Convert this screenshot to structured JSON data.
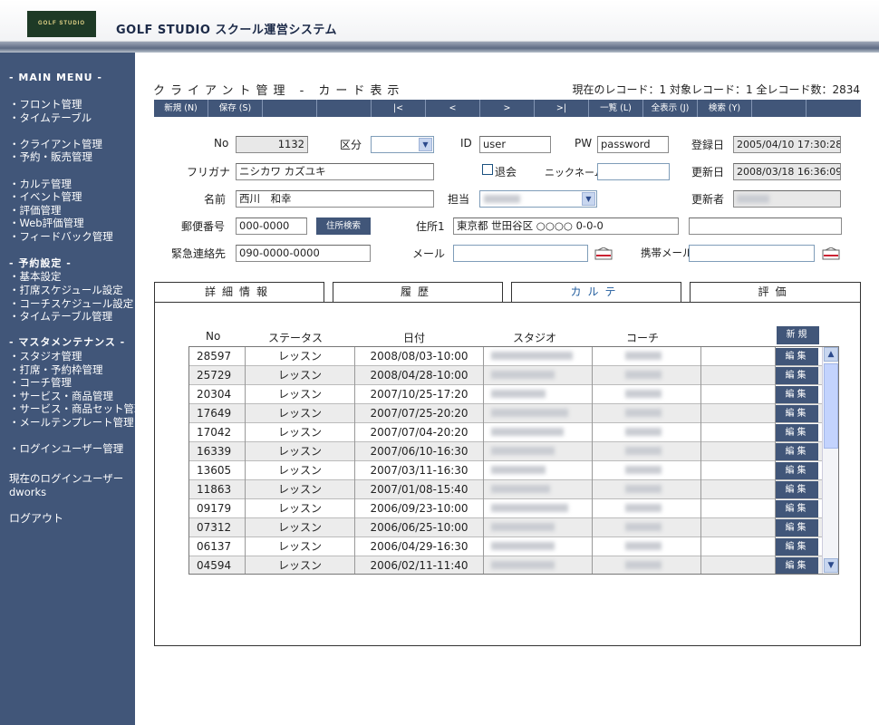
{
  "header": {
    "logo_text": "GOLF STUDIO",
    "app_title": "GOLF STUDIO スクール運営システム"
  },
  "sidebar": {
    "main_menu": "- MAIN MENU -",
    "items": [
      "・フロント管理",
      "・タイムテーブル",
      "・クライアント管理",
      "・予約・販売管理",
      "・カルテ管理",
      "・イベント管理",
      "・評価管理",
      "・Web評価管理",
      "・フィードバック管理"
    ],
    "reserve_head": "- 予約設定 -",
    "reserve_items": [
      "・基本設定",
      "・打席スケジュール設定",
      "・コーチスケジュール設定",
      "・タイムテーブル管理"
    ],
    "master_head": "- マスタメンテナンス -",
    "master_items": [
      "・スタジオ管理",
      "・打席・予約枠管理",
      "・コーチ管理",
      "・サービス・商品管理",
      "・サービス・商品セット管理",
      "・メールテンプレート管理"
    ],
    "login_user_mgmt": "・ログインユーザー管理",
    "current_user_label": "現在のログインユーザー",
    "current_user": "dworks",
    "logout": "ログアウト"
  },
  "page": {
    "title": "クライアント管理 - カード表示",
    "record_info": "現在のレコード：1 対象レコード：1 全レコード数：2834"
  },
  "toolbar": {
    "buttons": [
      "新規 (N)",
      "保存 (S)",
      "",
      "",
      "|<",
      "<",
      ">",
      ">|",
      "一覧 (L)",
      "全表示 (J)",
      "検索 (Y)",
      "",
      ""
    ]
  },
  "form": {
    "no_label": "No",
    "no_value": "1132",
    "kubun_label": "区分",
    "kubun_value": "",
    "id_label": "ID",
    "id_value": "user",
    "pw_label": "PW",
    "pw_value": "password",
    "registered_label": "登録日",
    "registered_value": "2005/04/10 17:30:28",
    "furigana_label": "フリガナ",
    "furigana_value": "ニシカワ カズユキ",
    "withdraw_label": "退会",
    "nickname_label": "ニックネーム",
    "nickname_value": "",
    "updated_label": "更新日",
    "updated_value": "2008/03/18 16:36:09",
    "name_label": "名前",
    "name_value": "西川　和幸",
    "staff_label": "担当",
    "updater_label": "更新者",
    "zip_label": "郵便番号",
    "zip_value": "000-0000",
    "address_search": "住所検索",
    "address1_label": "住所1",
    "address1_value": "東京都 世田谷区 ○○○○ 0-0-0",
    "address2_value": "",
    "emergency_label": "緊急連絡先",
    "emergency_value": "090-0000-0000",
    "mail_label": "メール",
    "mail_value": "",
    "mobile_mail_label": "携帯メール",
    "mobile_mail_value": ""
  },
  "tabs": [
    {
      "label": "詳細情報",
      "active": false
    },
    {
      "label": "履歴",
      "active": false
    },
    {
      "label": "カルテ",
      "active": true
    },
    {
      "label": "評価",
      "active": false
    }
  ],
  "karte": {
    "columns": [
      "No",
      "ステータス",
      "日付",
      "スタジオ",
      "コーチ"
    ],
    "new_button": "新規",
    "edit_label": "編集",
    "rows": [
      {
        "no": "28597",
        "status": "レッスン",
        "date": "2008/08/03-10:00"
      },
      {
        "no": "25729",
        "status": "レッスン",
        "date": "2008/04/28-10:00"
      },
      {
        "no": "20304",
        "status": "レッスン",
        "date": "2007/10/25-17:20"
      },
      {
        "no": "17649",
        "status": "レッスン",
        "date": "2007/07/25-20:20"
      },
      {
        "no": "17042",
        "status": "レッスン",
        "date": "2007/07/04-20:20"
      },
      {
        "no": "16339",
        "status": "レッスン",
        "date": "2007/06/10-16:30"
      },
      {
        "no": "13605",
        "status": "レッスン",
        "date": "2007/03/11-16:30"
      },
      {
        "no": "11863",
        "status": "レッスン",
        "date": "2007/01/08-15:40"
      },
      {
        "no": "09179",
        "status": "レッスン",
        "date": "2006/09/23-10:00"
      },
      {
        "no": "07312",
        "status": "レッスン",
        "date": "2006/06/25-10:00"
      },
      {
        "no": "06137",
        "status": "レッスン",
        "date": "2006/04/29-16:30"
      },
      {
        "no": "04594",
        "status": "レッスン",
        "date": "2006/02/11-11:40"
      }
    ]
  },
  "colors": {
    "accent": "#415679",
    "active_tab_text": "#1e5a9c"
  }
}
